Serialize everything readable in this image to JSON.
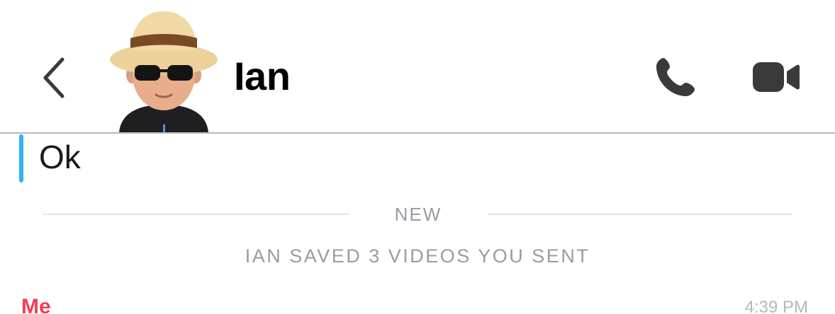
{
  "header": {
    "contact_name": "Ian",
    "back_icon": "chevron-left-icon",
    "call_icon": "phone-icon",
    "video_icon": "video-camera-icon"
  },
  "messages": {
    "last_message": "Ok",
    "divider_label": "NEW",
    "saved_notice": "IAN SAVED 3 VIDEOS YOU SENT",
    "next_sender": "Me",
    "next_timestamp": "4:39 PM"
  },
  "colors": {
    "accent_blue": "#2fb3f5",
    "sender_me_red": "#f23c57",
    "muted_gray": "#9b9ca3"
  }
}
